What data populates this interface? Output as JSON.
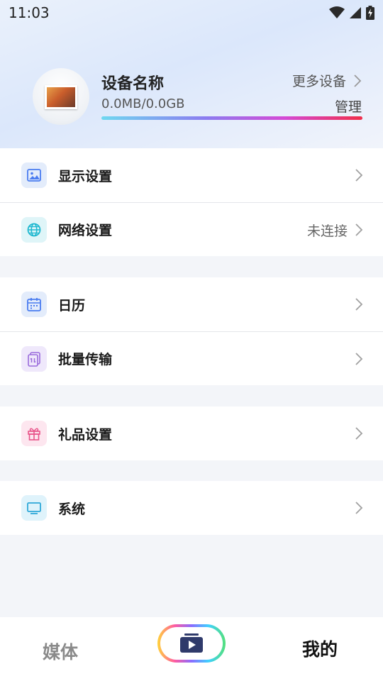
{
  "status_bar": {
    "time": "11:03"
  },
  "device": {
    "name": "设备名称",
    "storage": "0.0MB/0.0GB",
    "more_devices": "更多设备",
    "manage": "管理"
  },
  "menu": {
    "display": {
      "label": "显示设置"
    },
    "network": {
      "label": "网络设置",
      "value": "未连接"
    },
    "calendar": {
      "label": "日历"
    },
    "transfer": {
      "label": "批量传输"
    },
    "gift": {
      "label": "礼品设置"
    },
    "system": {
      "label": "系统"
    }
  },
  "tabs": {
    "media": "媒体",
    "mine": "我的"
  },
  "colors": {
    "accent_blue": "#4a7cf0",
    "storage_gradient": [
      "#6fd8f0",
      "#8b7cf0",
      "#d44ad6",
      "#f02d4a"
    ]
  }
}
